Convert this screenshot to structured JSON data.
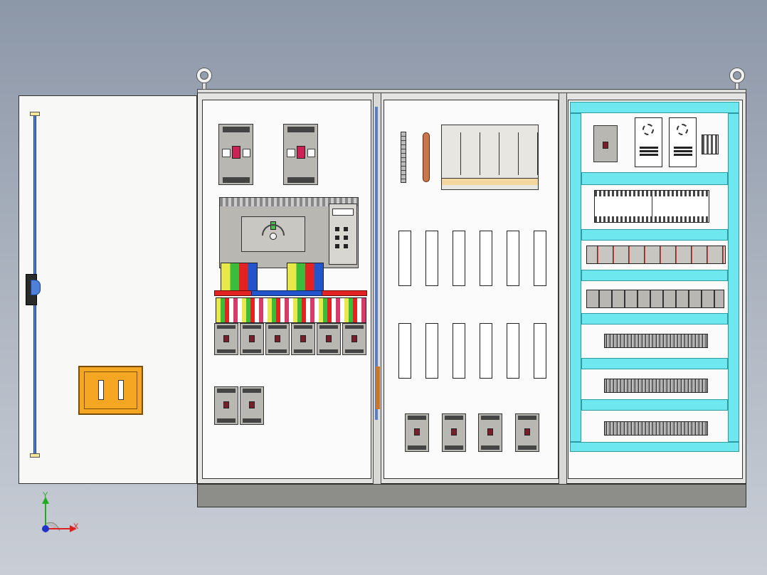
{
  "axes": {
    "y_label": "Y",
    "x_label": "X"
  },
  "colors": {
    "background_top": "#8c97a8",
    "cabinet": "#e4e4e2",
    "panel": "#fbfbfb",
    "handle": "#f5a623",
    "cyan_rail": "#6ee7ef",
    "busbar_red": "#e32222",
    "busbar_blue": "#2255cc"
  },
  "icons": [
    "lifting-eye-icon",
    "door-handle-icon",
    "axis-triad-icon"
  ]
}
